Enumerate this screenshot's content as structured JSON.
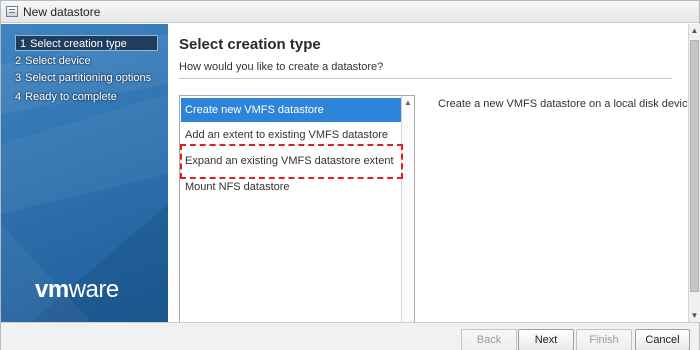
{
  "window": {
    "title": "New datastore"
  },
  "sidebar": {
    "steps": [
      {
        "number": "1",
        "label": "Select creation type",
        "active": true
      },
      {
        "number": "2",
        "label": "Select device",
        "active": false
      },
      {
        "number": "3",
        "label": "Select partitioning options",
        "active": false
      },
      {
        "number": "4",
        "label": "Ready to complete",
        "active": false
      }
    ],
    "logo": {
      "vm": "vm",
      "ware": "ware"
    }
  },
  "main": {
    "heading": "Select creation type",
    "subheading": "How would you like to create a datastore?",
    "options": [
      {
        "label": "Create new VMFS datastore",
        "selected": true
      },
      {
        "label": "Add an extent to existing VMFS datastore",
        "selected": false
      },
      {
        "label": "Expand an existing VMFS datastore extent",
        "selected": false,
        "highlighted": true
      },
      {
        "label": "Mount NFS datastore",
        "selected": false
      }
    ],
    "description": "Create a new VMFS datastore on a local disk device"
  },
  "footer": {
    "back": "Back",
    "next": "Next",
    "finish": "Finish",
    "cancel": "Cancel"
  },
  "colors": {
    "selection": "#2e84d8",
    "highlight": "#e02020",
    "sidebar": "#2f72b0"
  }
}
